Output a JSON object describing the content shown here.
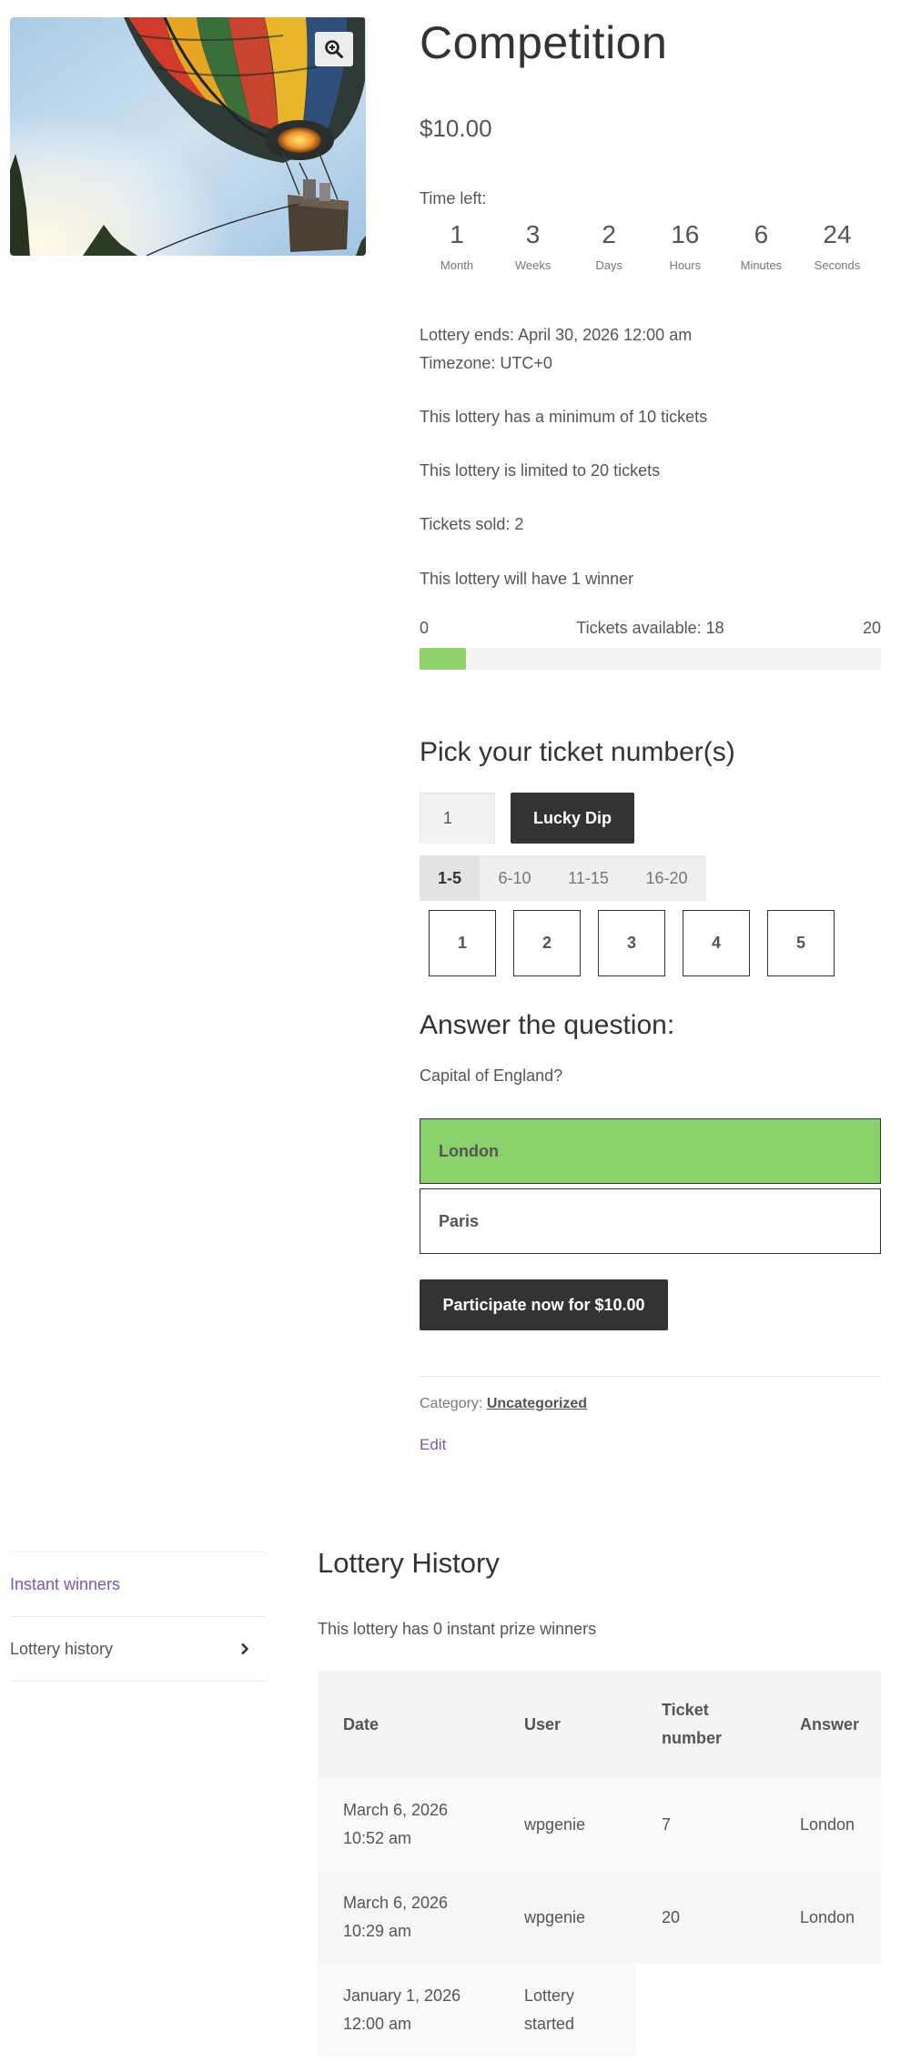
{
  "product": {
    "title": "Competition",
    "price": "$10.00",
    "image_icon": "hot-air-balloon-photo",
    "zoom_icon": "zoom-in-icon"
  },
  "countdown": {
    "label": "Time left:",
    "units": [
      {
        "value": "1",
        "unit": "Month"
      },
      {
        "value": "3",
        "unit": "Weeks"
      },
      {
        "value": "2",
        "unit": "Days"
      },
      {
        "value": "16",
        "unit": "Hours"
      },
      {
        "value": "6",
        "unit": "Minutes"
      },
      {
        "value": "24",
        "unit": "Seconds"
      }
    ]
  },
  "info": {
    "ends": "Lottery ends: April 30, 2026 12:00 am",
    "timezone": "Timezone: UTC+0",
    "minimum": "This lottery has a minimum of 10 tickets",
    "limit": "This lottery is limited to 20 tickets",
    "sold": "Tickets sold: 2",
    "winners": "This lottery will have 1 winner"
  },
  "progress": {
    "min_label": "0",
    "available_label": "Tickets available: 18",
    "max_label": "20",
    "sold": 2,
    "total": 20,
    "fill_color": "#8fd16a"
  },
  "pick": {
    "heading": "Pick your ticket number(s)",
    "quantity_value": "1",
    "lucky_dip_label": "Lucky Dip",
    "ranges": [
      "1-5",
      "6-10",
      "11-15",
      "16-20"
    ],
    "active_range": "1-5",
    "tickets": [
      "1",
      "2",
      "3",
      "4",
      "5"
    ]
  },
  "quiz": {
    "heading": "Answer the question:",
    "question": "Capital of England?",
    "answers": [
      "London",
      "Paris"
    ],
    "selected": "London",
    "selected_color": "#8bd16b"
  },
  "cta": {
    "participate_label": "Participate now for $10.00"
  },
  "meta": {
    "category_label": "Category:",
    "category_link": "Uncategorized",
    "edit_label": "Edit"
  },
  "tabs": {
    "items": [
      {
        "label": "Instant winners",
        "active": true
      },
      {
        "label": "Lottery history",
        "active": false
      }
    ],
    "chevron_icon": "chevron-right-icon"
  },
  "history": {
    "title": "Lottery History",
    "note": "This lottery has 0 instant prize winners",
    "headers": [
      "Date",
      "User",
      "Ticket number",
      "Answer"
    ],
    "rows": [
      {
        "date": "March 6, 2026 10:52 am",
        "user": "wpgenie",
        "ticket": "7",
        "answer": "London"
      },
      {
        "date": "March 6, 2026 10:29 am",
        "user": "wpgenie",
        "ticket": "20",
        "answer": "London"
      },
      {
        "date": "January 1, 2026 12:00 am",
        "user": "Lottery started",
        "ticket": "",
        "answer": ""
      }
    ]
  },
  "colors": {
    "accent_purple": "#7f54b3",
    "button_dark": "#333333"
  }
}
